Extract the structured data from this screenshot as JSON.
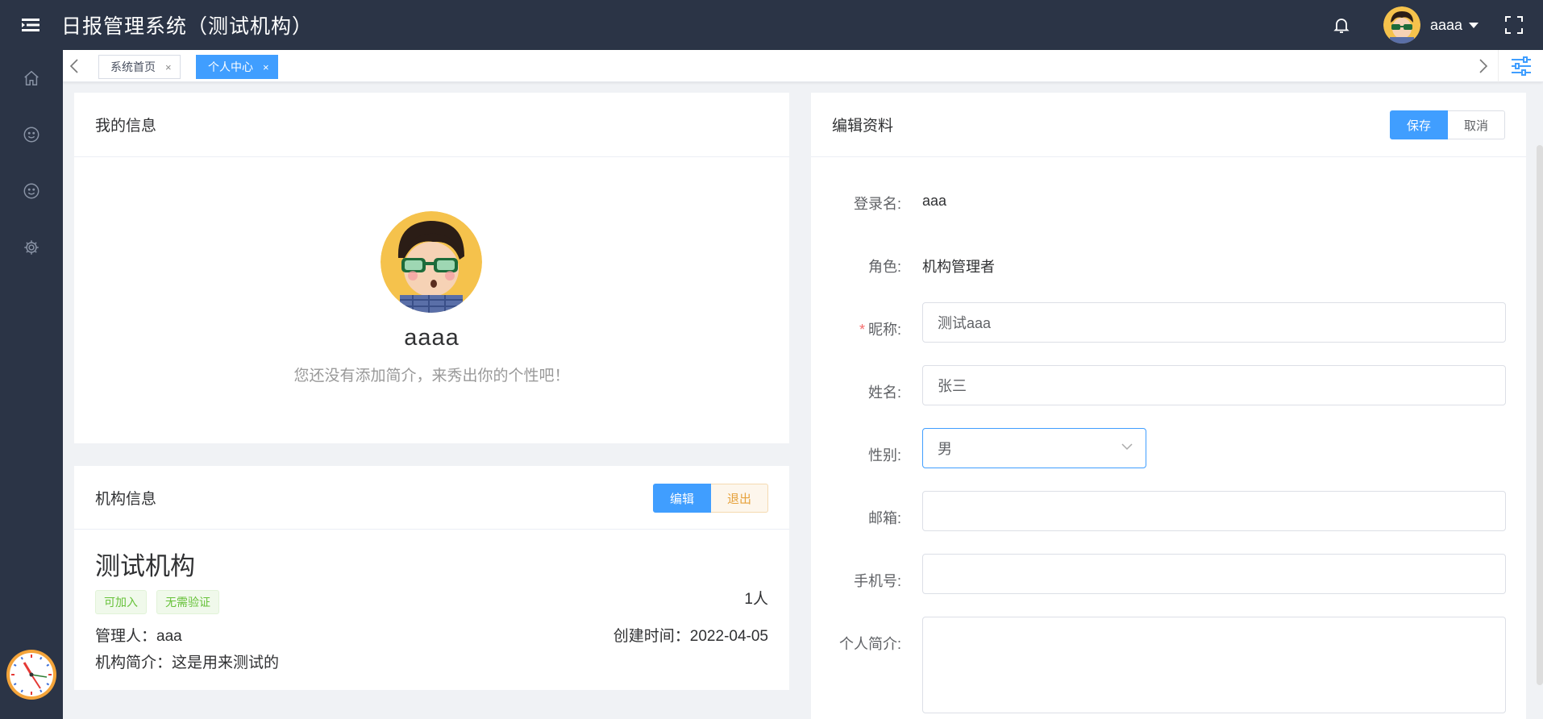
{
  "header": {
    "title": "日报管理系统（测试机构）",
    "username": "aaaa"
  },
  "tabs": [
    {
      "label": "系统首页",
      "active": false
    },
    {
      "label": "个人中心",
      "active": true
    }
  ],
  "profile_card": {
    "title": "我的信息",
    "name": "aaaa",
    "intro": "您还没有添加简介，来秀出你的个性吧！"
  },
  "org_card": {
    "title": "机构信息",
    "edit_label": "编辑",
    "exit_label": "退出",
    "org_name": "测试机构",
    "tags": [
      "可加入",
      "无需验证"
    ],
    "member_count": "1人",
    "manager": "管理人：aaa",
    "created": "创建时间：2022-04-05",
    "intro": "机构简介：这是用来测试的"
  },
  "edit_card": {
    "title": "编辑资料",
    "save_label": "保存",
    "cancel_label": "取消",
    "fields": {
      "login_label": "登录名:",
      "login_value": "aaa",
      "role_label": "角色:",
      "role_value": "机构管理者",
      "nickname_label": "昵称:",
      "nickname_value": "测试aaa",
      "realname_label": "姓名:",
      "realname_value": "张三",
      "gender_label": "性别:",
      "gender_value": "男",
      "email_label": "邮箱:",
      "email_value": "",
      "phone_label": "手机号:",
      "phone_value": "",
      "bio_label": "个人简介:",
      "bio_value": ""
    }
  },
  "colors": {
    "header_bg": "#2b3446",
    "primary": "#409eff",
    "warning": "#e6a23c",
    "success": "#67c23a",
    "danger": "#f56c6c"
  },
  "icons": {
    "menu": "hamburger-icon",
    "bell": "bell-icon",
    "fullscreen": "fullscreen-icon",
    "side": [
      "home-icon",
      "smile-icon",
      "smile-icon",
      "gear-icon"
    ],
    "tab_settings": "sliders-icon",
    "clock": "clock-icon"
  }
}
